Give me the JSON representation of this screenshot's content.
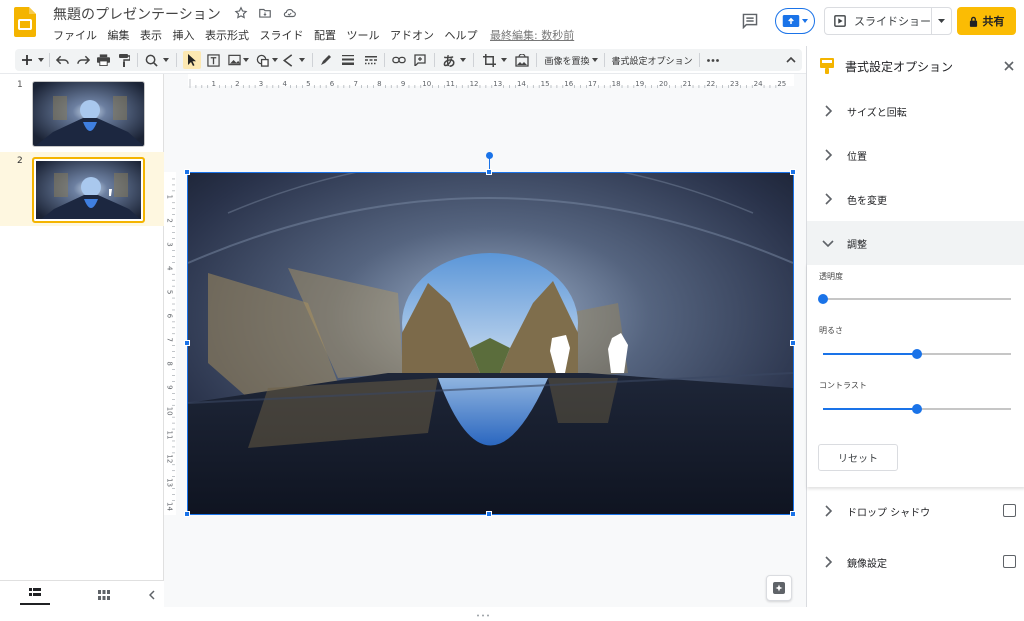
{
  "header": {
    "doc_title": "無題のプレゼンテーション",
    "menu": [
      "ファイル",
      "編集",
      "表示",
      "挿入",
      "表示形式",
      "スライド",
      "配置",
      "ツール",
      "アドオン",
      "ヘルプ"
    ],
    "last_edit": "最終編集: 数秒前",
    "slideshow_label": "スライドショー",
    "share_label": "共有"
  },
  "toolbar": {
    "replace_image_label": "画像を置換",
    "format_options_label": "書式設定オプション",
    "font_glyph": "あ",
    "ruler_numbers": [
      "1",
      "2",
      "3",
      "4",
      "5",
      "6",
      "7",
      "8",
      "9",
      "10",
      "11",
      "12",
      "13",
      "14",
      "15",
      "16",
      "17",
      "18",
      "19",
      "20",
      "21",
      "22",
      "23",
      "24",
      "25"
    ],
    "vruler_numbers": [
      "1",
      "2",
      "3",
      "4",
      "5",
      "6",
      "7",
      "8",
      "9",
      "10",
      "11",
      "12",
      "13",
      "14"
    ]
  },
  "filmstrip": {
    "slides": [
      {
        "number": "1"
      },
      {
        "number": "2"
      }
    ]
  },
  "panel": {
    "title": "書式設定オプション",
    "sections": {
      "size_rotation": "サイズと回転",
      "position": "位置",
      "recolor": "色を変更",
      "adjustments": "調整",
      "drop_shadow": "ドロップ シャドウ",
      "reflection": "鏡像設定"
    },
    "adjustments": {
      "transparency_label": "透明度",
      "transparency_value": 0.0,
      "brightness_label": "明るさ",
      "brightness_value": 0.5,
      "contrast_label": "コントラスト",
      "contrast_value": 0.5,
      "reset_label": "リセット"
    },
    "drop_shadow_checked": false,
    "reflection_checked": false
  },
  "colors": {
    "accent": "#1a73e8",
    "share": "#fbbc04",
    "selected_slide_bg": "#fef7e0"
  }
}
